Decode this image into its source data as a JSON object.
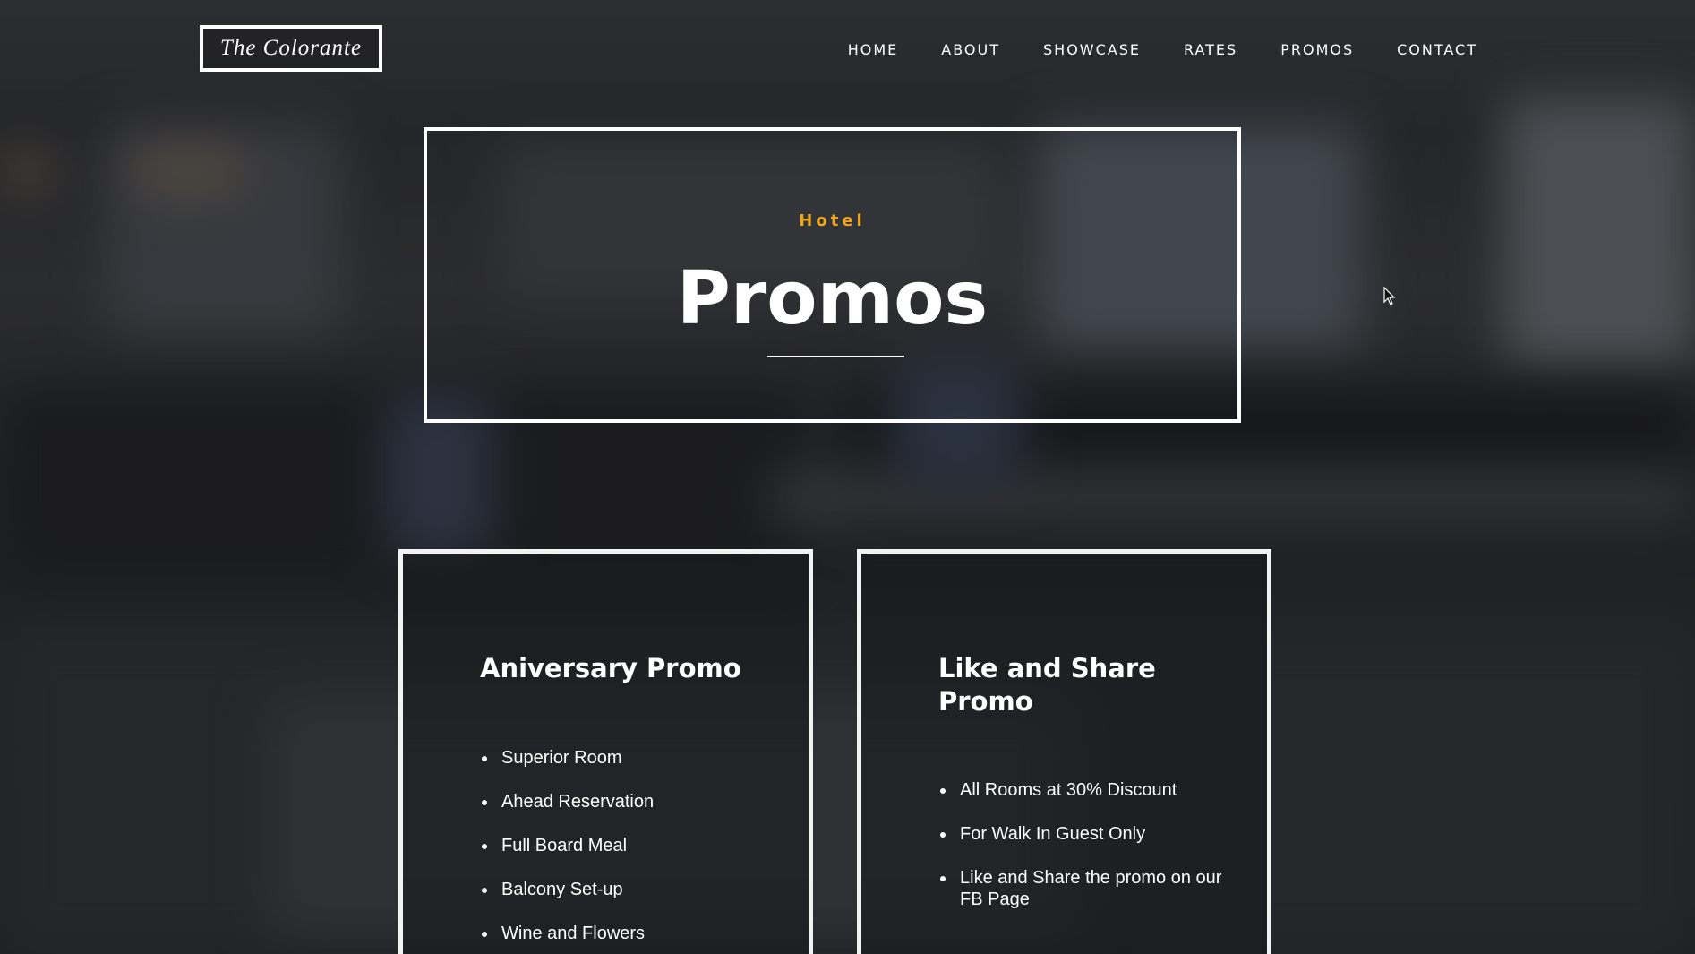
{
  "header": {
    "logo_text": "The Colorante",
    "nav": [
      {
        "label": "HOME"
      },
      {
        "label": "ABOUT"
      },
      {
        "label": "SHOWCASE"
      },
      {
        "label": "RATES"
      },
      {
        "label": "PROMOS"
      },
      {
        "label": "CONTACT"
      }
    ]
  },
  "hero": {
    "eyebrow": "Hotel",
    "title": "Promos"
  },
  "promos": [
    {
      "title": "Aniversary Promo",
      "items": [
        "Superior Room",
        "Ahead Reservation",
        "Full Board Meal",
        "Balcony Set-up",
        "Wine and Flowers"
      ]
    },
    {
      "title": "Like and Share Promo",
      "items": [
        "All Rooms at 30% Discount",
        "For Walk In Guest Only",
        "Like and Share the promo on our FB Page"
      ]
    }
  ],
  "colors": {
    "accent": "#f0a51e",
    "text": "#ffffff"
  },
  "icons": {
    "cursor": "mouse-pointer-icon"
  }
}
